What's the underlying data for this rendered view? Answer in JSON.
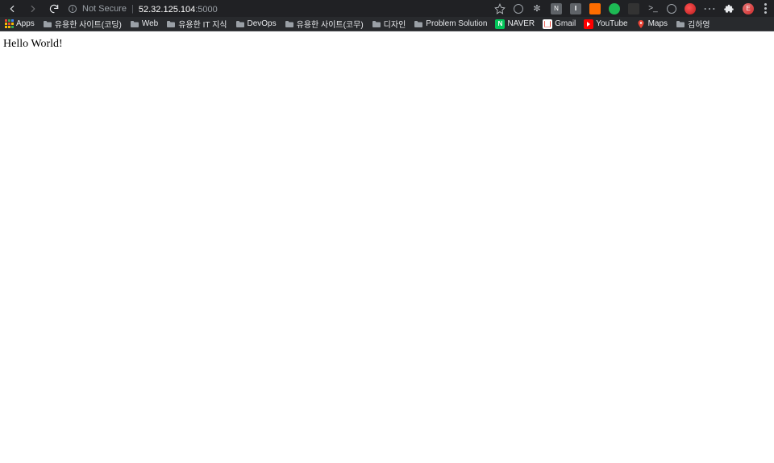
{
  "toolbar": {
    "back_enabled": true,
    "forward_enabled": false,
    "security_text": "Not Secure",
    "url_host": "52.32.125.104",
    "url_port": ":5000",
    "avatar_initial": "E"
  },
  "bookmarks": {
    "apps_label": "Apps",
    "items": [
      {
        "label": "유용한 사이트(코딩)",
        "type": "folder"
      },
      {
        "label": "Web",
        "type": "folder"
      },
      {
        "label": "유용한 IT 지식",
        "type": "folder"
      },
      {
        "label": "DevOps",
        "type": "folder"
      },
      {
        "label": "유용한 사이트(코무)",
        "type": "folder"
      },
      {
        "label": "디자인",
        "type": "folder"
      },
      {
        "label": "Problem Solution",
        "type": "folder"
      },
      {
        "label": "NAVER",
        "type": "naver"
      },
      {
        "label": "Gmail",
        "type": "gmail"
      },
      {
        "label": "YouTube",
        "type": "youtube"
      },
      {
        "label": "Maps",
        "type": "maps"
      },
      {
        "label": "김하영",
        "type": "folder"
      }
    ]
  },
  "page": {
    "body_text": "Hello World!"
  }
}
